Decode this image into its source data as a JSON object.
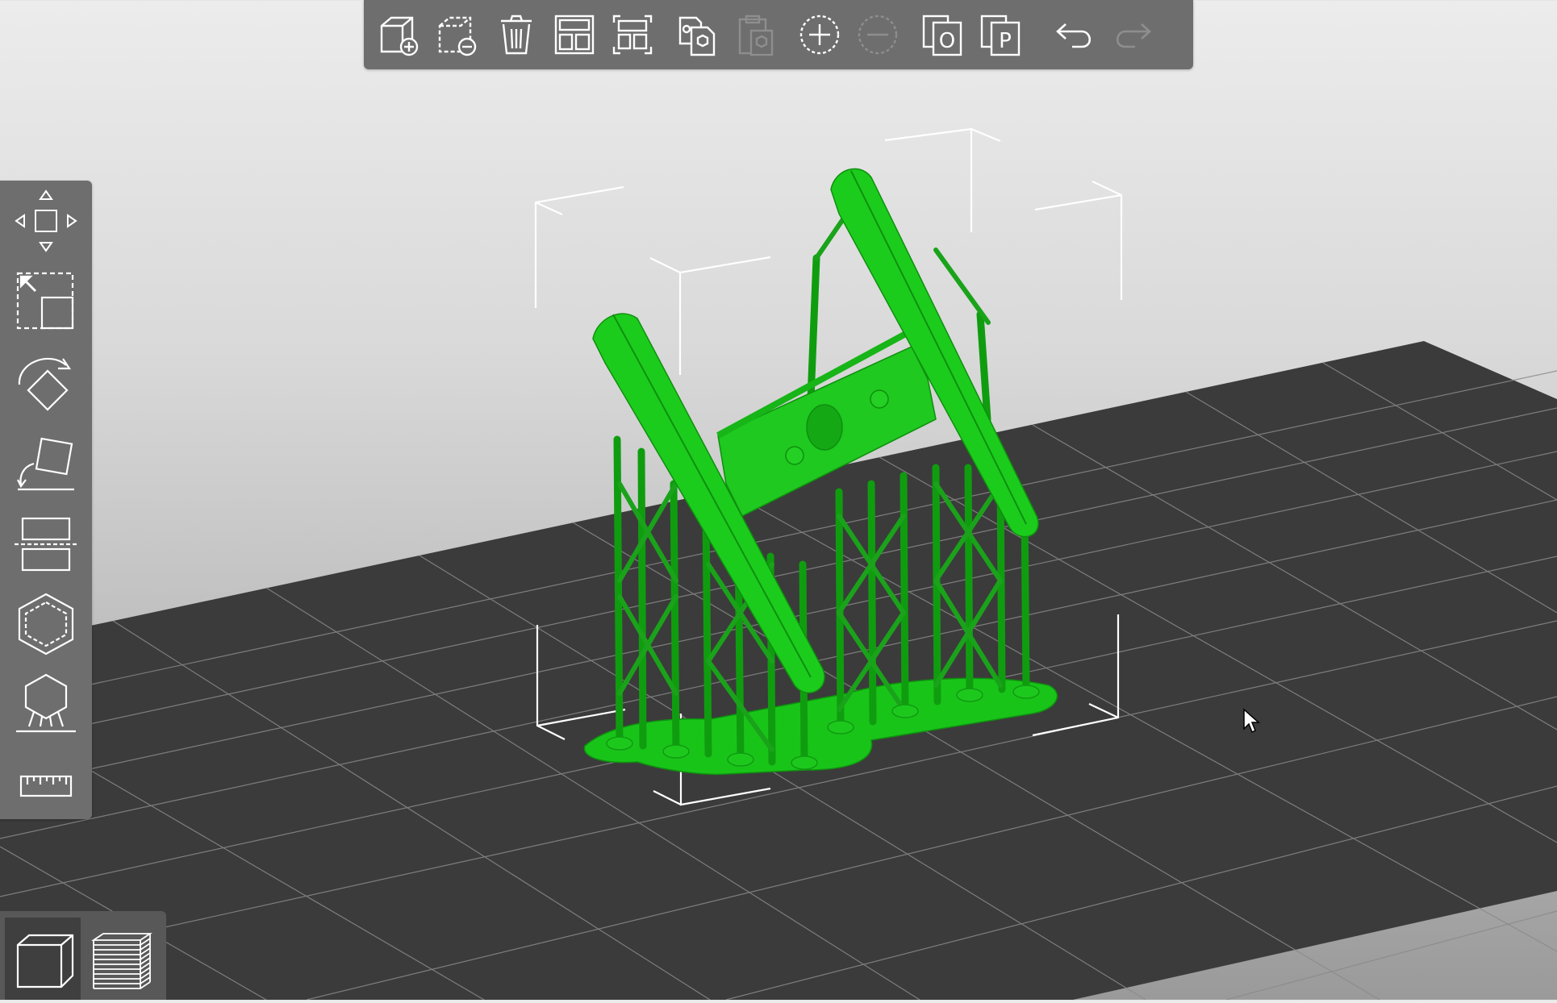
{
  "app": {
    "colors": {
      "model": "#19c419",
      "bed": "#3b3b3b",
      "grid_line": "#8a8a8a",
      "panel": "#6e6e6e",
      "icon": "#ffffff",
      "icon_disabled": "#8e8e8e",
      "bounding_box": "#ffffff"
    }
  },
  "top_toolbar": {
    "buttons": [
      {
        "icon": "add-object-icon",
        "enabled": true
      },
      {
        "icon": "delete-object-icon",
        "enabled": true
      },
      {
        "icon": "delete-all-icon",
        "enabled": true
      },
      {
        "icon": "arrange-icon",
        "enabled": true
      },
      {
        "icon": "arrange-selection-icon",
        "enabled": true
      },
      {
        "icon": "copy-icon",
        "enabled": true
      },
      {
        "icon": "paste-icon",
        "enabled": false
      },
      {
        "icon": "add-instance-icon",
        "enabled": true
      },
      {
        "icon": "remove-instance-icon",
        "enabled": false
      },
      {
        "icon": "split-to-objects-icon",
        "enabled": true
      },
      {
        "icon": "split-to-parts-icon",
        "enabled": true
      },
      {
        "icon": "undo-icon",
        "enabled": true
      },
      {
        "icon": "redo-icon",
        "enabled": false
      }
    ],
    "split_objects_letter": "O",
    "split_parts_letter": "P"
  },
  "left_toolbar": {
    "tools": [
      {
        "icon": "move-icon"
      },
      {
        "icon": "scale-icon"
      },
      {
        "icon": "rotate-icon"
      },
      {
        "icon": "place-on-face-icon"
      },
      {
        "icon": "cut-icon"
      },
      {
        "icon": "hollow-icon"
      },
      {
        "icon": "support-points-icon"
      },
      {
        "icon": "measure-icon"
      }
    ]
  },
  "view_toggle": {
    "buttons": [
      {
        "icon": "3d-view-icon",
        "active": true
      },
      {
        "icon": "preview-layers-icon",
        "active": false
      }
    ]
  }
}
